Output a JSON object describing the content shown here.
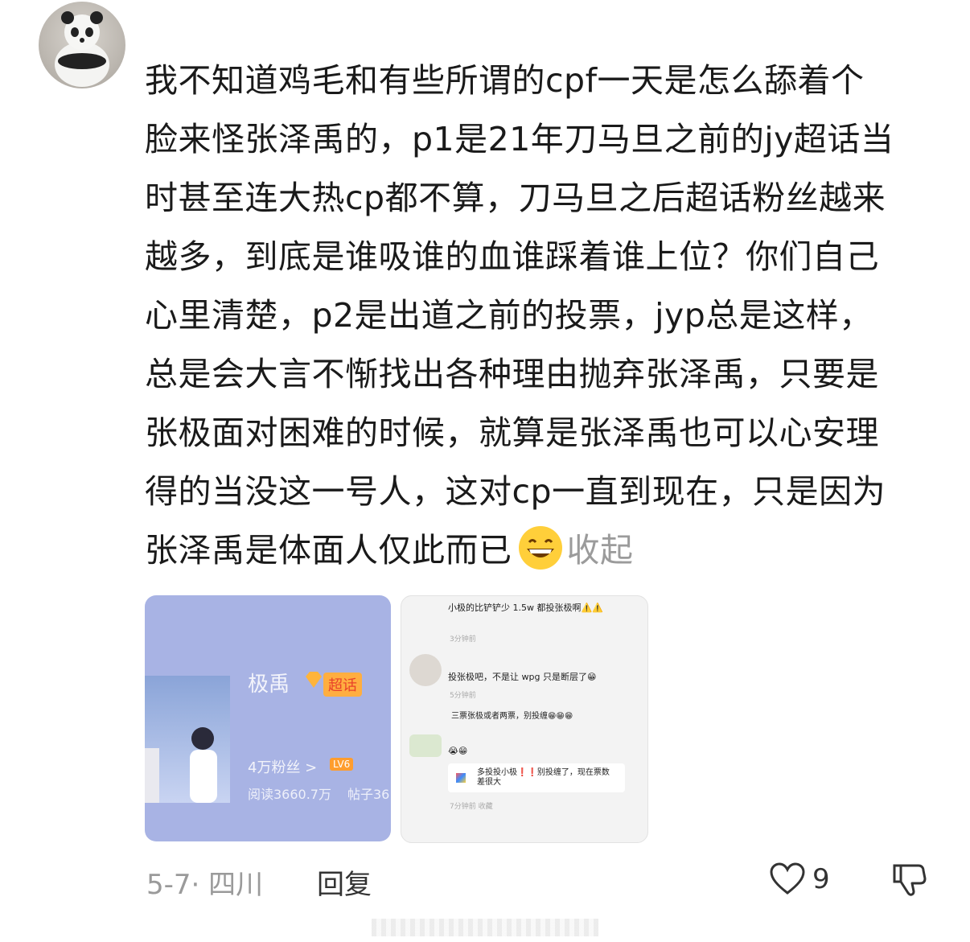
{
  "comment": {
    "avatar_icon": "panda-avatar",
    "lines": [
      "我不知道鸡毛和有些所谓的cpf一天是怎么舔着个",
      "脸来怪张泽禹的，p1是21年刀马旦之前的jy超话当",
      "时甚至连大热cp都不算，刀马旦之后超话粉丝越来",
      "越多，到底是谁吸谁的血谁踩着谁上位？你们自己",
      "心里清楚，p2是出道之前的投票，jyp总是这样，",
      "总是会大言不惭找出各种理由抛弃张泽禹，只要是",
      "张极面对困难的时候，就算是张泽禹也可以心安理",
      "得的当没这一号人，这对cp一直到现在，只是因为",
      "张泽禹是体面人仅此而已"
    ],
    "emoji_icon": "grinning-face-emoji",
    "collapse_label": "收起"
  },
  "image1": {
    "title": "极禹",
    "badge": "超话",
    "fans": "4万粉丝 >",
    "level": "LV6",
    "reads": "阅读3660.7万",
    "posts": "帖子36"
  },
  "image2": {
    "msgs": [
      {
        "text": "小极的比铲铲少 1.5w 都投张极啊⚠️⚠️",
        "time": "3分钟前"
      },
      {
        "text": "投张极吧，不是让 wpg 只是断层了😁",
        "time": "5分钟前"
      },
      {
        "text": "三票张极或者两票，别投缠😁😁😁",
        "time": ""
      },
      {
        "text": "😭😁",
        "time": ""
      },
      {
        "text": "多投投小极❗❗别投缠了，现在票数差很大",
        "time": "7分钟前 收藏"
      }
    ]
  },
  "footer": {
    "date_location": "5-7· 四川",
    "reply_label": "回复",
    "like_count": "9"
  }
}
